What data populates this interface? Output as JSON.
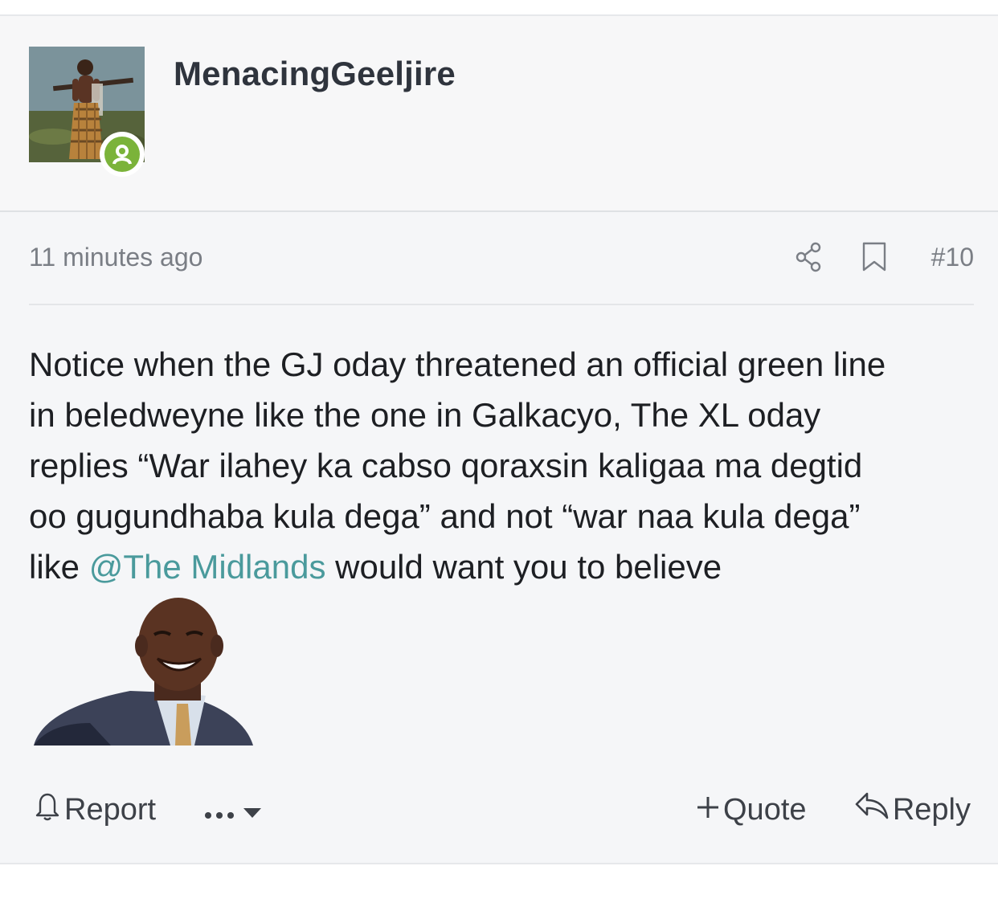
{
  "post": {
    "username": "MenacingGeeljire",
    "timestamp": "11 minutes ago",
    "post_number": "#10",
    "message_before_mention": "Notice when the GJ oday threatened an official green line\nin beledweyne like the one in Galkacyo, The XL oday\nreplies “War ilahey ka cabso qoraxsin kaligaa ma degtid\noo gugundhaba kula dega” and not “war naa kula dega”\nlike ",
    "mention": "@The Midlands",
    "message_after_mention": " would want you to believe",
    "online_status_color": "#7bb33a",
    "mention_color": "#4a9a9c"
  },
  "actions": {
    "report_label": "Report",
    "quote_label": "Quote",
    "reply_label": "Reply"
  }
}
